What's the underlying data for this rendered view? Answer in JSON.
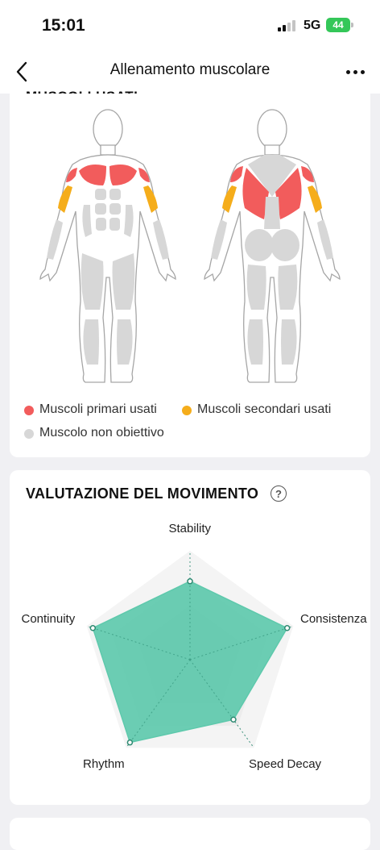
{
  "status": {
    "time": "15:01",
    "network": "5G",
    "battery": "44"
  },
  "nav": {
    "title": "Allenamento muscolare",
    "back_icon": "chevron-left-icon",
    "more_icon": "more-horizontal-icon"
  },
  "muscles": {
    "title": "MUSCOLI USATI",
    "colors": {
      "primary": "#f25c5c",
      "secondary": "#f5ad1b",
      "inactive": "#d7d7d7"
    },
    "legend": {
      "primary": "Muscoli primari usati",
      "secondary": "Muscoli secondari usati",
      "inactive": "Muscolo non obiettivo"
    }
  },
  "evaluation": {
    "title": "VALUTAZIONE DEL MOVIMENTO",
    "help_icon": "question-circle-icon",
    "fill_color": "#5ec9ac",
    "axes": [
      {
        "label": "Stability",
        "score": 0.72
      },
      {
        "label": "Consistenza",
        "score": 0.94
      },
      {
        "label": "Speed Decay",
        "score": 0.68
      },
      {
        "label": "Rhythm",
        "score": 0.94
      },
      {
        "label": "Continuity",
        "score": 0.94
      }
    ]
  }
}
